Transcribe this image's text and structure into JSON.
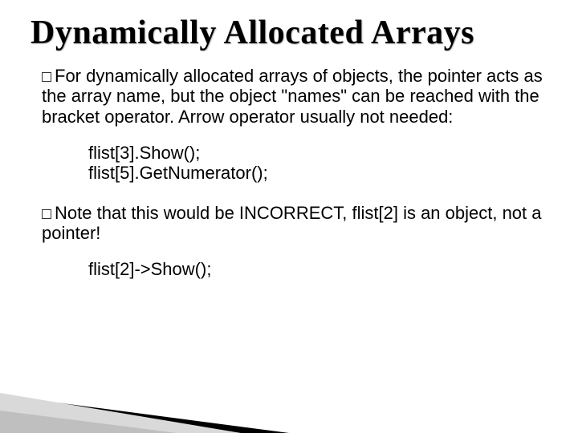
{
  "title": "Dynamically Allocated Arrays",
  "paragraphs": {
    "p1_lead": "For",
    "p1_rest": " dynamically allocated arrays of objects, the pointer acts as the array name, but the object \"names\" can be reached with the bracket operator. Arrow operator usually not needed:",
    "code1_line1": "flist[3].Show();",
    "code1_line2": "flist[5].GetNumerator();",
    "p2_lead": "Note",
    "p2_rest": " that this would be INCORRECT, flist[2] is an object, not a pointer!",
    "code2_line1": "flist[2]->Show();"
  }
}
